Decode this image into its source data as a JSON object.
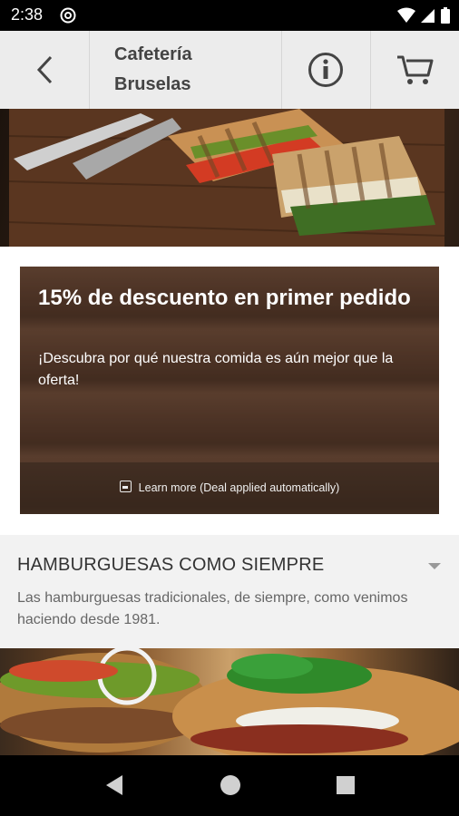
{
  "status_bar": {
    "time": "2:38",
    "icons": [
      "at-sign-icon",
      "wifi-icon",
      "signal-icon",
      "battery-icon"
    ]
  },
  "header": {
    "title": "Cafetería Bruselas",
    "back_icon": "chevron-left-icon",
    "info_icon": "info-icon",
    "cart_icon": "cart-icon"
  },
  "hero": {
    "image": "panini-sandwich-photo"
  },
  "promo": {
    "title": "15% de descuento en primer pedido",
    "subtitle": "¡Descubra por qué nuestra comida es aún mejor que la oferta!",
    "learn_more": "Learn more (Deal applied automatically)"
  },
  "category": {
    "title": "HAMBURGUESAS COMO SIEMPRE",
    "description": "Las hamburguesas tradicionales, de siempre, como venimos haciendo desde 1981.",
    "image": "burger-photo"
  },
  "nav": {
    "back_icon": "triangle-back-icon",
    "home_icon": "circle-home-icon",
    "recents_icon": "square-recents-icon"
  },
  "colors": {
    "app_bar": "#ececec",
    "icon_gray": "#444444",
    "category_bg": "#f2f2f2",
    "text_dark": "#333333"
  }
}
